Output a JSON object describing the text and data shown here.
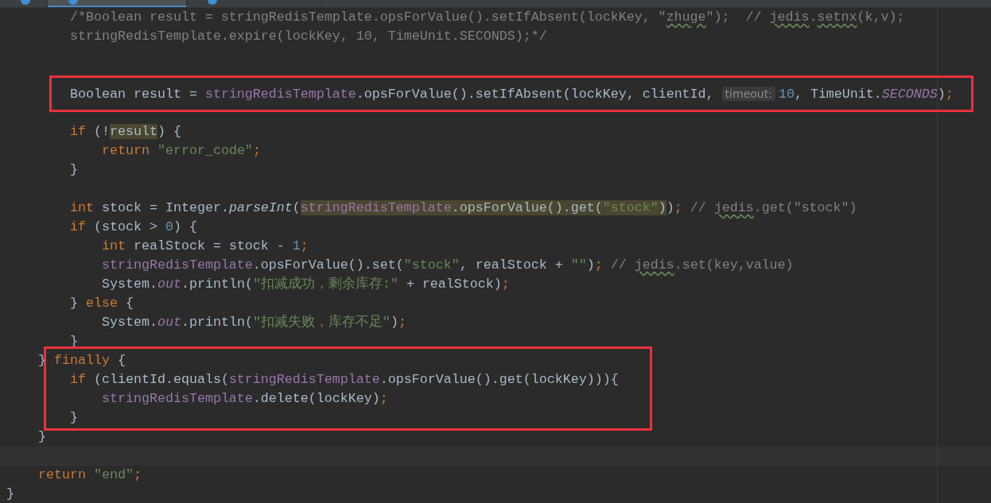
{
  "tabs": [
    {
      "selected": false
    },
    {
      "selected": true
    },
    {
      "selected": false
    }
  ],
  "lines": [
    {
      "kind": "code",
      "tokens": [
        {
          "kind": "comment",
          "text": "        /*Boolean result = stringRedisTemplate.opsForValue().setIfAbsent(lockKey, \""
        },
        {
          "kind": "comment-typo",
          "text": "zhuge"
        },
        {
          "kind": "comment",
          "text": "\");  // "
        },
        {
          "kind": "comment-typo",
          "text": "jedis"
        },
        {
          "kind": "comment",
          "text": "."
        },
        {
          "kind": "comment-typo",
          "text": "setnx"
        },
        {
          "kind": "comment",
          "text": "(k,v);"
        }
      ]
    },
    {
      "kind": "code",
      "tokens": [
        {
          "kind": "comment",
          "text": "        stringRedisTemplate.expire(lockKey, 10, TimeUnit.SECONDS);*/"
        }
      ]
    },
    {
      "kind": "blank"
    },
    {
      "kind": "blank"
    },
    {
      "kind": "frame",
      "lines": [
        {
          "kind": "code",
          "tokens": [
            {
              "kind": "plain",
              "text": "        Boolean result = "
            },
            {
              "kind": "member",
              "text": "stringRedisTemplate"
            },
            {
              "kind": "plain",
              "text": ".opsForValue().setIfAbsent(lockKey, clientId, "
            },
            {
              "kind": "hint",
              "text": "timeout:"
            },
            {
              "kind": "number",
              "text": "10"
            },
            {
              "kind": "plain",
              "text": ", TimeUnit."
            },
            {
              "kind": "static-member",
              "text": "SECONDS"
            },
            {
              "kind": "plain",
              "text": ")"
            },
            {
              "kind": "keyword",
              "text": ";"
            }
          ]
        }
      ]
    },
    {
      "kind": "blank"
    },
    {
      "kind": "code",
      "tokens": [
        {
          "kind": "keyword",
          "text": "        if "
        },
        {
          "kind": "plain",
          "text": "(!"
        },
        {
          "kind": "plain-marked",
          "text": "result"
        },
        {
          "kind": "plain",
          "text": ") {"
        }
      ]
    },
    {
      "kind": "code",
      "tokens": [
        {
          "kind": "keyword",
          "text": "            return "
        },
        {
          "kind": "string",
          "text": "\"error_code\""
        },
        {
          "kind": "keyword",
          "text": ";"
        }
      ]
    },
    {
      "kind": "code",
      "tokens": [
        {
          "kind": "plain",
          "text": "        }"
        }
      ]
    },
    {
      "kind": "blank"
    },
    {
      "kind": "code",
      "tokens": [
        {
          "kind": "keyword",
          "text": "        int "
        },
        {
          "kind": "plain",
          "text": "stock = Integer."
        },
        {
          "kind": "static",
          "text": "parseInt"
        },
        {
          "kind": "plain",
          "text": "("
        },
        {
          "kind": "member-marked",
          "text": "stringRedisTemplate"
        },
        {
          "kind": "plain-marked",
          "text": ".opsForValue().get("
        },
        {
          "kind": "string-marked",
          "text": "\"stock\""
        },
        {
          "kind": "plain-marked",
          "text": ")"
        },
        {
          "kind": "plain",
          "text": ")"
        },
        {
          "kind": "keyword",
          "text": "; "
        },
        {
          "kind": "comment",
          "text": "// "
        },
        {
          "kind": "comment-typo",
          "text": "jedis"
        },
        {
          "kind": "comment",
          "text": ".get(\"stock\")"
        }
      ]
    },
    {
      "kind": "code",
      "tokens": [
        {
          "kind": "keyword",
          "text": "        if "
        },
        {
          "kind": "plain",
          "text": "(stock > "
        },
        {
          "kind": "number",
          "text": "0"
        },
        {
          "kind": "plain",
          "text": ") {"
        }
      ]
    },
    {
      "kind": "code",
      "tokens": [
        {
          "kind": "keyword",
          "text": "            int "
        },
        {
          "kind": "plain",
          "text": "realStock = stock - "
        },
        {
          "kind": "number",
          "text": "1"
        },
        {
          "kind": "keyword",
          "text": ";"
        }
      ]
    },
    {
      "kind": "code",
      "tokens": [
        {
          "kind": "member",
          "text": "            stringRedisTemplate"
        },
        {
          "kind": "plain",
          "text": ".opsForValue().set("
        },
        {
          "kind": "string",
          "text": "\"stock\""
        },
        {
          "kind": "plain",
          "text": ", realStock + "
        },
        {
          "kind": "string",
          "text": "\"\""
        },
        {
          "kind": "plain",
          "text": ")"
        },
        {
          "kind": "keyword",
          "text": "; "
        },
        {
          "kind": "comment",
          "text": "// "
        },
        {
          "kind": "comment-typo",
          "text": "jedis"
        },
        {
          "kind": "comment",
          "text": ".set(key,value)"
        }
      ]
    },
    {
      "kind": "code",
      "tokens": [
        {
          "kind": "plain",
          "text": "            System."
        },
        {
          "kind": "static-member",
          "text": "out"
        },
        {
          "kind": "plain",
          "text": ".println("
        },
        {
          "kind": "string",
          "text": "\"扣减成功，剩余库存:\""
        },
        {
          "kind": "plain",
          "text": " + realStock)"
        },
        {
          "kind": "keyword",
          "text": ";"
        }
      ]
    },
    {
      "kind": "code",
      "tokens": [
        {
          "kind": "plain",
          "text": "        } "
        },
        {
          "kind": "keyword",
          "text": "else "
        },
        {
          "kind": "plain",
          "text": "{"
        }
      ]
    },
    {
      "kind": "code",
      "tokens": [
        {
          "kind": "plain",
          "text": "            System."
        },
        {
          "kind": "static-member",
          "text": "out"
        },
        {
          "kind": "plain",
          "text": ".println("
        },
        {
          "kind": "string",
          "text": "\"扣减失败，库存不足\""
        },
        {
          "kind": "plain",
          "text": ")"
        },
        {
          "kind": "keyword",
          "text": ";"
        }
      ]
    },
    {
      "kind": "code",
      "tokens": [
        {
          "kind": "plain",
          "text": "        }"
        }
      ]
    },
    {
      "kind": "frame2",
      "lines": [
        {
          "kind": "code",
          "tokens": [
            {
              "kind": "plain",
              "text": "    } "
            },
            {
              "kind": "keyword",
              "text": "finally "
            },
            {
              "kind": "plain",
              "text": "{"
            }
          ]
        },
        {
          "kind": "code",
          "tokens": [
            {
              "kind": "keyword",
              "text": "        if "
            },
            {
              "kind": "plain",
              "text": "(clientId.equals("
            },
            {
              "kind": "member",
              "text": "stringRedisTemplate"
            },
            {
              "kind": "plain",
              "text": ".opsForValue().get(lockKey))){"
            }
          ]
        },
        {
          "kind": "code",
          "tokens": [
            {
              "kind": "member",
              "text": "            stringRedisTemplate"
            },
            {
              "kind": "plain",
              "text": ".delete(lockKey)"
            },
            {
              "kind": "keyword",
              "text": ";"
            }
          ]
        },
        {
          "kind": "code",
          "tokens": [
            {
              "kind": "plain",
              "text": "        }"
            }
          ]
        }
      ]
    },
    {
      "kind": "code",
      "tokens": [
        {
          "kind": "plain",
          "text": "    }"
        }
      ]
    },
    {
      "kind": "current"
    },
    {
      "kind": "code",
      "tokens": [
        {
          "kind": "keyword",
          "text": "    return "
        },
        {
          "kind": "string",
          "text": "\"end\""
        },
        {
          "kind": "keyword",
          "text": ";"
        }
      ]
    },
    {
      "kind": "code",
      "tokens": [
        {
          "kind": "plain",
          "text": "}"
        }
      ]
    }
  ]
}
